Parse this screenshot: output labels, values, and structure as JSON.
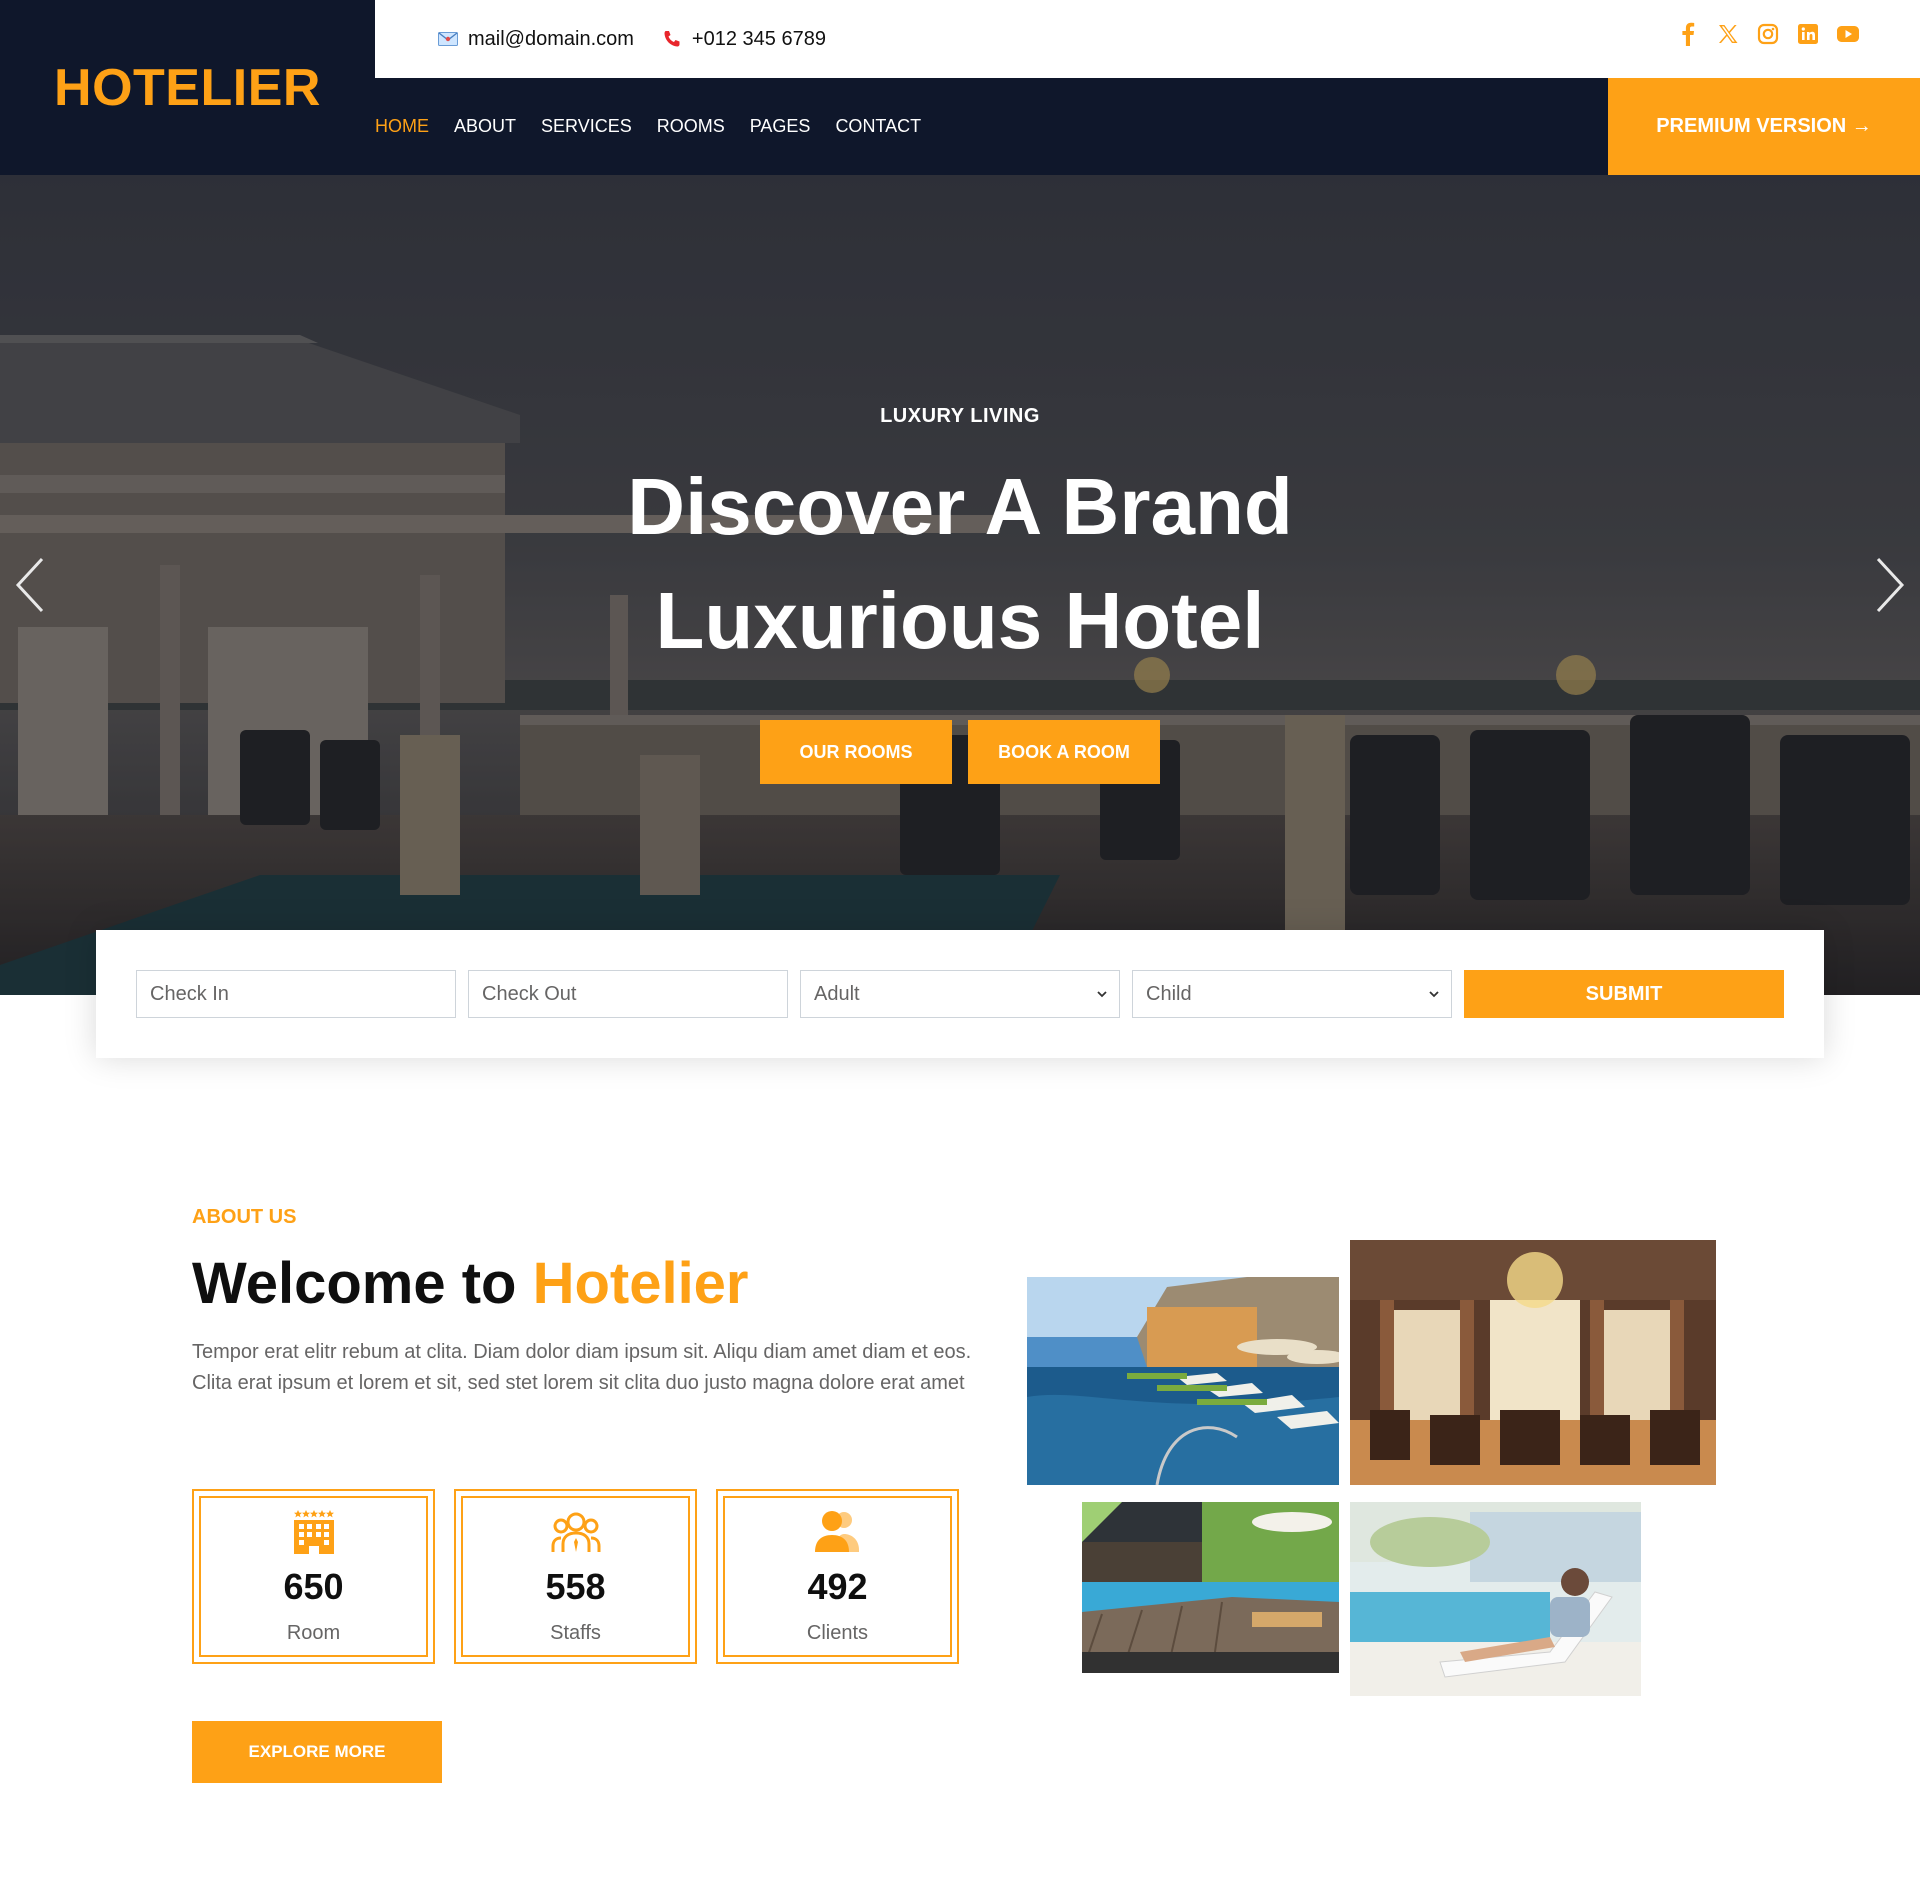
{
  "brand": {
    "name": "HOTELIER"
  },
  "topbar": {
    "email": "mail@domain.com",
    "phone": "+012 345 6789",
    "socials": [
      "facebook-icon",
      "x-twitter-icon",
      "instagram-icon",
      "linkedin-icon",
      "youtube-icon"
    ]
  },
  "nav": {
    "items": [
      "HOME",
      "ABOUT",
      "SERVICES",
      "ROOMS",
      "PAGES",
      "CONTACT"
    ],
    "active": "HOME",
    "premium_label": "PREMIUM VERSION →"
  },
  "hero": {
    "subtitle": "LUXURY LIVING",
    "title_line1": "Discover A Brand",
    "title_line2": "Luxurious Hotel",
    "btn_rooms": "OUR ROOMS",
    "btn_book": "BOOK A ROOM"
  },
  "booking": {
    "checkin_placeholder": "Check In",
    "checkout_placeholder": "Check Out",
    "adult_selected": "Adult",
    "child_selected": "Child",
    "submit_label": "SUBMIT"
  },
  "about": {
    "kicker": "ABOUT US",
    "title_prefix": "Welcome to ",
    "title_accent": "Hotelier",
    "text": "Tempor erat elitr rebum at clita. Diam dolor diam ipsum sit. Aliqu diam amet diam et eos. Clita erat ipsum et lorem et sit, sed stet lorem sit clita duo justo magna dolore erat amet",
    "stats": [
      {
        "icon": "hotel-icon",
        "number": "650",
        "label": "Room"
      },
      {
        "icon": "users-cog-icon",
        "number": "558",
        "label": "Staffs"
      },
      {
        "icon": "users-icon",
        "number": "492",
        "label": "Clients"
      }
    ],
    "explore_label": "EXPLORE MORE"
  },
  "colors": {
    "primary": "#fea116",
    "dark": "#0f172b",
    "text": "#666565",
    "white": "#ffffff"
  }
}
